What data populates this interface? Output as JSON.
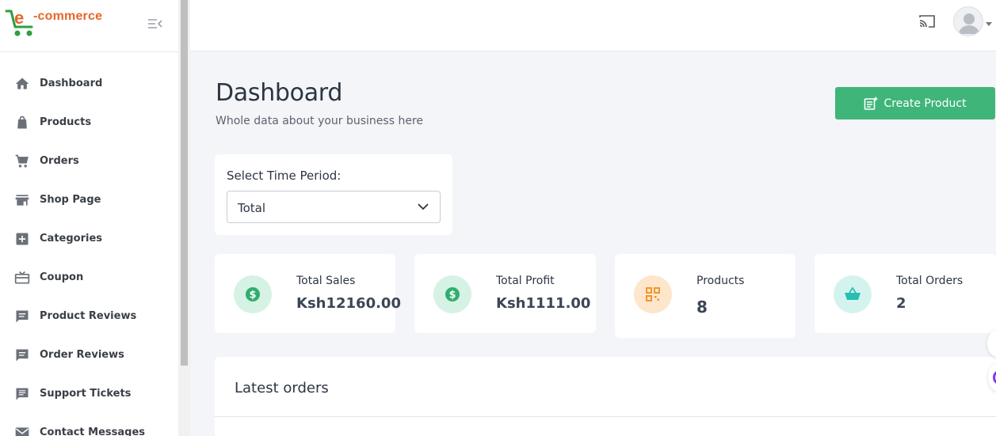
{
  "brand": {
    "logo_prefix": "e",
    "logo_text": "-commerce",
    "accent": "#e8652a",
    "cart_color": "#2e9e3f"
  },
  "sidebar": {
    "items": [
      {
        "label": "Dashboard",
        "icon": "home-icon"
      },
      {
        "label": "Products",
        "icon": "shopping-bag-icon"
      },
      {
        "label": "Orders",
        "icon": "shopping-cart-icon"
      },
      {
        "label": "Shop Page",
        "icon": "storefront-icon"
      },
      {
        "label": "Categories",
        "icon": "add-box-icon"
      },
      {
        "label": "Coupon",
        "icon": "gift-card-icon"
      },
      {
        "label": "Product Reviews",
        "icon": "comment-icon"
      },
      {
        "label": "Order Reviews",
        "icon": "comment-icon"
      },
      {
        "label": "Support Tickets",
        "icon": "support-chat-icon"
      },
      {
        "label": "Contact Messages",
        "icon": "mail-icon"
      }
    ]
  },
  "header": {
    "cast_icon": "cast-icon",
    "avatar_icon": "user-avatar-icon"
  },
  "main": {
    "title": "Dashboard",
    "subtitle": "Whole data about your business here",
    "create_button": "Create Product",
    "period": {
      "label": "Select Time Period:",
      "value": "Total"
    },
    "stats": [
      {
        "label": "Total Sales",
        "value": "Ksh12160.00",
        "icon": "dollar-icon",
        "color": "#2fae6e",
        "bg": "#d6f2e4"
      },
      {
        "label": "Total Profit",
        "value": "Ksh1111.00",
        "icon": "dollar-icon",
        "color": "#2fae6e",
        "bg": "#d6f2e4"
      },
      {
        "label": "Products",
        "value": "8",
        "icon": "qr-code-icon",
        "color": "#f0962e",
        "bg": "#fde6cc"
      },
      {
        "label": "Total Orders",
        "value": "2",
        "icon": "basket-icon",
        "color": "#26bfb0",
        "bg": "#d4f3ef"
      }
    ],
    "latest_orders_title": "Latest orders"
  },
  "colors": {
    "primary_green": "#3fb57a",
    "background": "#f4f5f8"
  }
}
